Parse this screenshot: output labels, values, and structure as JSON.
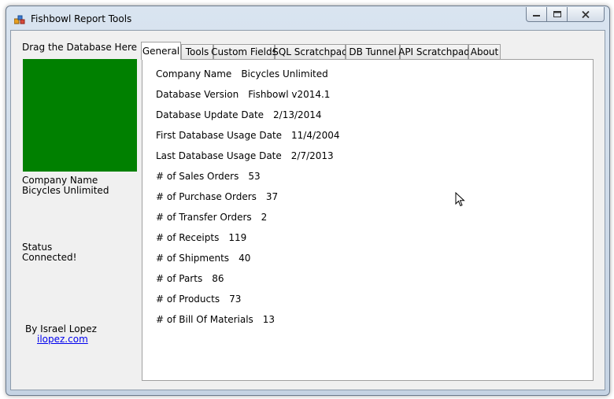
{
  "window": {
    "title": "Fishbowl Report Tools"
  },
  "sidebar": {
    "drop_label": "Drag the Database Here",
    "company_label": "Company Name",
    "company_value": "Bicycles Unlimited",
    "status_label": "Status",
    "status_value": "Connected!",
    "author": "By Israel Lopez",
    "link": "ilopez.com",
    "drop_zone_color": "#008000"
  },
  "tabs": [
    "General",
    "Tools",
    "Custom Fields",
    "SQL Scratchpad",
    "DB Tunnel",
    "API Scratchpad",
    "About"
  ],
  "active_tab": "General",
  "general": [
    {
      "label": "Company Name",
      "value": "Bicycles Unlimited"
    },
    {
      "label": "Database Version",
      "value": "Fishbowl v2014.1"
    },
    {
      "label": "Database Update Date",
      "value": "2/13/2014"
    },
    {
      "label": "First Database Usage Date",
      "value": "11/4/2004"
    },
    {
      "label": "Last Database Usage Date",
      "value": "2/7/2013"
    },
    {
      "label": "# of Sales Orders",
      "value": "53"
    },
    {
      "label": "# of Purchase Orders",
      "value": "37"
    },
    {
      "label": "# of Transfer Orders",
      "value": "2"
    },
    {
      "label": "# of Receipts",
      "value": "119"
    },
    {
      "label": "# of Shipments",
      "value": "40"
    },
    {
      "label": "# of Parts",
      "value": "86"
    },
    {
      "label": "# of Products",
      "value": "73"
    },
    {
      "label": "# of Bill Of Materials",
      "value": "13"
    }
  ]
}
